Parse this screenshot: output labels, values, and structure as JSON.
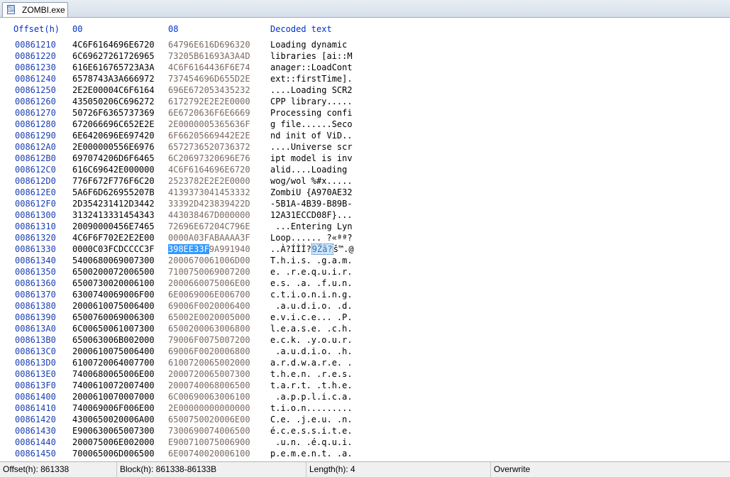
{
  "tab": {
    "title": "ZOMBI.exe",
    "icon": "exe-file-icon",
    "icon_text": "0110 1001"
  },
  "header": {
    "offset": "Offset(h)",
    "col1": "00",
    "col2": "08",
    "decoded": "Decoded text"
  },
  "rows": [
    {
      "off": "00861210",
      "h1": "4C6F6164696E6720",
      "h2": "64796E616D696320",
      "dec": "Loading dynamic "
    },
    {
      "off": "00861220",
      "h1": "6C69627261726965",
      "h2": "73205B61693A3A4D",
      "dec": "libraries [ai::M"
    },
    {
      "off": "00861230",
      "h1": "616E616765723A3A",
      "h2": "4C6F6164436F6E74",
      "dec": "anager::LoadCont"
    },
    {
      "off": "00861240",
      "h1": "6578743A3A666972",
      "h2": "737454696D655D2E",
      "dec": "ext::firstTime]."
    },
    {
      "off": "00861250",
      "h1": "2E2E00004C6F6164",
      "h2": "696E672053435232",
      "dec": "....Loading SCR2"
    },
    {
      "off": "00861260",
      "h1": "435050206C696272",
      "h2": "6172792E2E2E0000",
      "dec": "CPP library....."
    },
    {
      "off": "00861270",
      "h1": "50726F6365737369",
      "h2": "6E6720636F6E6669",
      "dec": "Processing confi"
    },
    {
      "off": "00861280",
      "h1": "672066696C652E2E",
      "h2": "2E0000005365636F",
      "dec": "g file......Seco"
    },
    {
      "off": "00861290",
      "h1": "6E6420696E697420",
      "h2": "6F66205669442E2E",
      "dec": "nd init of ViD.."
    },
    {
      "off": "008612A0",
      "h1": "2E000000556E6976",
      "h2": "6572736520736372",
      "dec": "....Universe scr"
    },
    {
      "off": "008612B0",
      "h1": "697074206D6F6465",
      "h2": "6C20697320696E76",
      "dec": "ipt model is inv"
    },
    {
      "off": "008612C0",
      "h1": "616C69642E000000",
      "h2": "4C6F6164696E6720",
      "dec": "alid....Loading "
    },
    {
      "off": "008612D0",
      "h1": "776F672F776F6C20",
      "h2": "2523782E2E2E0000",
      "dec": "wog/wol %#x....."
    },
    {
      "off": "008612E0",
      "h1": "5A6F6D626955207B",
      "h2": "4139373041453332",
      "dec": "ZombiU {A970AE32"
    },
    {
      "off": "008612F0",
      "h1": "2D354231412D3442",
      "h2": "33392D423839422D",
      "dec": "-5B1A-4B39-B89B-"
    },
    {
      "off": "00861300",
      "h1": "3132413331454343",
      "h2": "443038467D000000",
      "dec": "12A31ECCD08F}..."
    },
    {
      "off": "00861310",
      "h1": "20090000456E7465",
      "h2": "72696E67204C796E",
      "dec": " ...Entering Lyn"
    },
    {
      "off": "00861320",
      "h1": "4C6F6F702E2E2E00",
      "h2": "0000A03FABAAAA3F",
      "dec": "Loop...... ?«ªª?"
    },
    {
      "off": "00861330",
      "h1": "0000C03FCDCCCC3F",
      "h2": "398EE33F",
      "h2b": "9A991940",
      "dec": "..À?ÍÌÌ?",
      "decsel": "9Žã?",
      "dec2": "š™.@",
      "selrow": true
    },
    {
      "off": "00861340",
      "h1": "5400680069007300",
      "h2": "2000670061006D00",
      "dec": "T.h.i.s. .g.a.m."
    },
    {
      "off": "00861350",
      "h1": "6500200072006500",
      "h2": "7100750069007200",
      "dec": "e. .r.e.q.u.i.r."
    },
    {
      "off": "00861360",
      "h1": "6500730020006100",
      "h2": "2000660075006E00",
      "dec": "e.s. .a. .f.u.n."
    },
    {
      "off": "00861370",
      "h1": "6300740069006F00",
      "h2": "6E0069006E006700",
      "dec": "c.t.i.o.n.i.n.g."
    },
    {
      "off": "00861380",
      "h1": "2000610075006400",
      "h2": "69006F0020006400",
      "dec": " .a.u.d.i.o. .d."
    },
    {
      "off": "00861390",
      "h1": "6500760069006300",
      "h2": "65002E0020005000",
      "dec": "e.v.i.c.e... .P."
    },
    {
      "off": "008613A0",
      "h1": "6C00650061007300",
      "h2": "6500200063006800",
      "dec": "l.e.a.s.e. .c.h."
    },
    {
      "off": "008613B0",
      "h1": "650063006B002000",
      "h2": "79006F0075007200",
      "dec": "e.c.k. .y.o.u.r."
    },
    {
      "off": "008613C0",
      "h1": "2000610075006400",
      "h2": "69006F0020006800",
      "dec": " .a.u.d.i.o. .h."
    },
    {
      "off": "008613D0",
      "h1": "6100720064007700",
      "h2": "6100720065002000",
      "dec": "a.r.d.w.a.r.e. ."
    },
    {
      "off": "008613E0",
      "h1": "7400680065006E00",
      "h2": "2000720065007300",
      "dec": "t.h.e.n. .r.e.s."
    },
    {
      "off": "008613F0",
      "h1": "7400610072007400",
      "h2": "2000740068006500",
      "dec": "t.a.r.t. .t.h.e."
    },
    {
      "off": "00861400",
      "h1": "2000610070007000",
      "h2": "6C00690063006100",
      "dec": " .a.p.p.l.i.c.a."
    },
    {
      "off": "00861410",
      "h1": "740069006F006E00",
      "h2": "2E00000000000000",
      "dec": "t.i.o.n........."
    },
    {
      "off": "00861420",
      "h1": "4300650020006A00",
      "h2": "6500750020006E00",
      "dec": "C.e. .j.e.u. .n."
    },
    {
      "off": "00861430",
      "h1": "E900630065007300",
      "h2": "7300690074006500",
      "dec": "é.c.e.s.s.i.t.e."
    },
    {
      "off": "00861440",
      "h1": "200075006E002000",
      "h2": "E900710075006900",
      "dec": " .u.n. .é.q.u.i."
    },
    {
      "off": "00861450",
      "h1": "700065006D006500",
      "h2": "6E00740020006100",
      "dec": "p.e.m.e.n.t. .a."
    }
  ],
  "status": {
    "offset": "Offset(h): 861338",
    "block": "Block(h): 861338-86133B",
    "length": "Length(h): 4",
    "mode": "Overwrite"
  },
  "colors": {
    "selection": "#3399ff",
    "offset_text": "#1a3fb5",
    "header_text": "#0033cc"
  }
}
